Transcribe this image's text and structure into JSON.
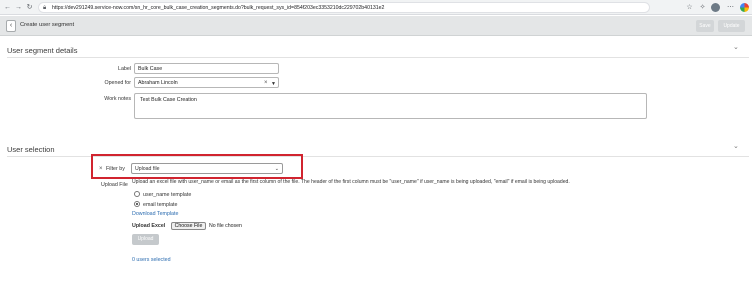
{
  "browser": {
    "url": "https://dev291249.service-now.com/sn_hr_core_bulk_case_creation_segments.do?bulk_request_sys_id=854f203ec3353210dc229702b40131e2"
  },
  "header": {
    "title": "Create user segment",
    "save_label": "Save",
    "update_label": "Update"
  },
  "details": {
    "title": "User segment details",
    "label_label": "Label",
    "label_value": "Bulk Case",
    "opened_for_label": "Opened for",
    "opened_for_value": "Abraham Lincoln",
    "work_notes_label": "Work notes",
    "work_notes_value": "Test Bulk Case Creation"
  },
  "selection": {
    "title": "User selection",
    "filter_label": "Filter by",
    "filter_value": "Upload file",
    "upload_file_label": "Upload File",
    "help_text": "Upload an excel file with user_name or email as the first column of the file. The header of the first column must be \"user_name\" if user_name is being uploaded, \"email\" if email is being uploaded.",
    "option_username": "user_name template",
    "option_email": "email template",
    "selected_option": "email template",
    "download_link": "Download Template",
    "upload_excel_label": "Upload Excel",
    "choose_file_label": "Choose File",
    "no_file_text": "No file chosen",
    "upload_button": "Upload",
    "users_selected": "0 users selected"
  }
}
